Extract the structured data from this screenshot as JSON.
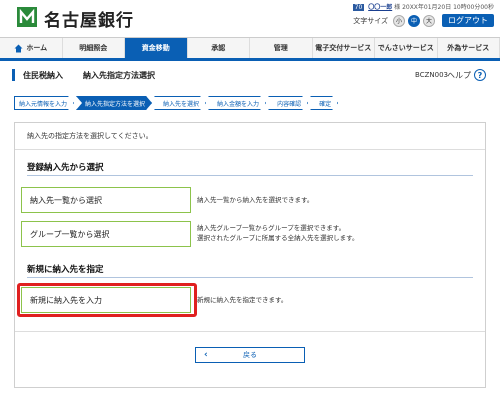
{
  "header": {
    "logo_text": "名古屋銀行",
    "user_badge": "70",
    "user_name": "〇〇一郎",
    "user_suffix": "様",
    "timestamp": "20XX年01月20日 10時00分00秒",
    "fontsize_label": "文字サイズ",
    "fontsize_small": "小",
    "fontsize_medium": "中",
    "fontsize_large": "大",
    "logout_label": "ログアウト"
  },
  "nav": {
    "items": [
      {
        "label": "ホーム",
        "icon": "home-icon"
      },
      {
        "label": "明細照会"
      },
      {
        "label": "資金移動"
      },
      {
        "label": "承認"
      },
      {
        "label": "管理"
      },
      {
        "label": "電子交付サービス"
      },
      {
        "label": "でんさいサービス"
      },
      {
        "label": "外為サービス"
      }
    ],
    "active_index": 2
  },
  "title": {
    "main": "住民税納入",
    "sub": "納入先指定方法選択",
    "screen_id": "BCZN003",
    "help_label": "ヘルプ",
    "help_icon": "?"
  },
  "steps": [
    {
      "label": "納入元情報を入力"
    },
    {
      "label": "納入先指定方法を選択"
    },
    {
      "label": "納入先を選択"
    },
    {
      "label": "納入金額を入力"
    },
    {
      "label": "内容確認"
    },
    {
      "label": "確定"
    }
  ],
  "content": {
    "instruction": "納入先の指定方法を選択してください。",
    "section1_title": "登録納入先から選択",
    "btn_list_label": "納入先一覧から選択",
    "btn_list_desc": "納入先一覧から納入先を選択できます。",
    "btn_group_label": "グループ一覧から選択",
    "btn_group_desc1": "納入先グループ一覧からグループを選択できます。",
    "btn_group_desc2": "選択されたグループに所属する全納入先を選択します。",
    "section2_title": "新規に納入先を指定",
    "btn_new_label": "新規に納入先を入力",
    "btn_new_desc": "新規に納入先を指定できます。",
    "back_label": "戻る",
    "back_icon": "‹"
  }
}
